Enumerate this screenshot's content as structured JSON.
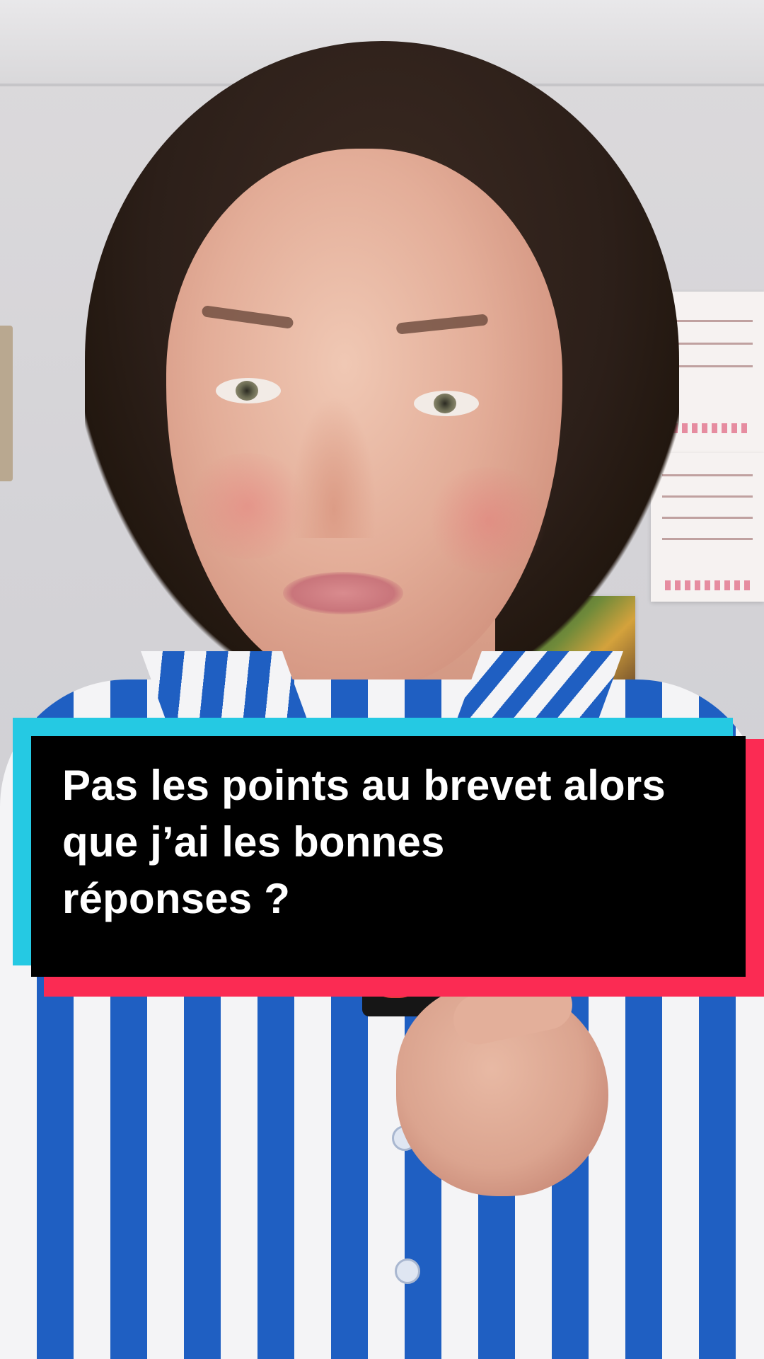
{
  "caption": {
    "lines": [
      "Pas les points au brevet alors",
      "que j’ai les bonnes",
      "réponses ?"
    ]
  },
  "colors": {
    "caption_cyan": "#25c9e3",
    "caption_red": "#fb2b53",
    "caption_bg": "#000000",
    "caption_text": "#ffffff",
    "shirt_blue": "#1f5fc2"
  }
}
